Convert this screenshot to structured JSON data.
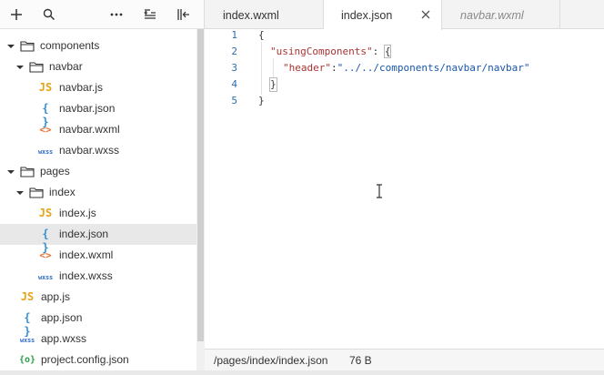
{
  "sidebar": {
    "toolbar": [
      "add-icon",
      "search-icon",
      "more-icon",
      "outline-icon",
      "collapse-icon"
    ],
    "tree": [
      {
        "label": "components",
        "type": "folder",
        "expanded": true,
        "depth": 0
      },
      {
        "label": "navbar",
        "type": "folder",
        "expanded": true,
        "depth": 1
      },
      {
        "label": "navbar.js",
        "type": "js",
        "icon_text": "JS",
        "depth": 2
      },
      {
        "label": "navbar.json",
        "type": "json",
        "icon_text": "{ }",
        "depth": 2
      },
      {
        "label": "navbar.wxml",
        "type": "wxml",
        "icon_text": "<>",
        "depth": 2
      },
      {
        "label": "navbar.wxss",
        "type": "wxss",
        "icon_text": "wxss",
        "depth": 2
      },
      {
        "label": "pages",
        "type": "folder",
        "expanded": true,
        "depth": 0
      },
      {
        "label": "index",
        "type": "folder",
        "expanded": true,
        "depth": 1
      },
      {
        "label": "index.js",
        "type": "js",
        "icon_text": "JS",
        "depth": 2
      },
      {
        "label": "index.json",
        "type": "json",
        "icon_text": "{ }",
        "depth": 2,
        "selected": true
      },
      {
        "label": "index.wxml",
        "type": "wxml",
        "icon_text": "<>",
        "depth": 2
      },
      {
        "label": "index.wxss",
        "type": "wxss",
        "icon_text": "wxss",
        "depth": 2
      },
      {
        "label": "app.js",
        "type": "js",
        "icon_text": "JS",
        "depth": 0
      },
      {
        "label": "app.json",
        "type": "json",
        "icon_text": "{ }",
        "depth": 0
      },
      {
        "label": "app.wxss",
        "type": "wxss",
        "icon_text": "wxss",
        "depth": 0
      },
      {
        "label": "project.config.json",
        "type": "cfg",
        "icon_text": "{o}",
        "depth": 0
      }
    ]
  },
  "tabs": [
    {
      "label": "index.wxml",
      "active": false
    },
    {
      "label": "index.json",
      "active": true,
      "close": "×"
    },
    {
      "label": "navbar.wxml",
      "active": false,
      "preview": true
    }
  ],
  "code": {
    "line_numbers": [
      "1",
      "2",
      "3",
      "4",
      "5"
    ],
    "line1": "{",
    "line2_key": "\"usingComponents\"",
    "line2_colon": ": ",
    "line2_brace": "{",
    "line3_key": "\"header\"",
    "line3_colon": ":",
    "line3_value": "\"../../components/navbar/navbar\"",
    "line4": "}",
    "line5": "}"
  },
  "status": {
    "path": "/pages/index/index.json",
    "size": "76 B"
  },
  "colors": {
    "js": "#e8a317",
    "json": "#2f8fd8",
    "wxml": "#e87030",
    "wxss": "#2f6fc8",
    "config": "#2aa04a",
    "line_number": "#2b6cb0",
    "string_key": "#a33333",
    "string_value": "#1a56a8",
    "selected_row": "#e8e8e8"
  }
}
